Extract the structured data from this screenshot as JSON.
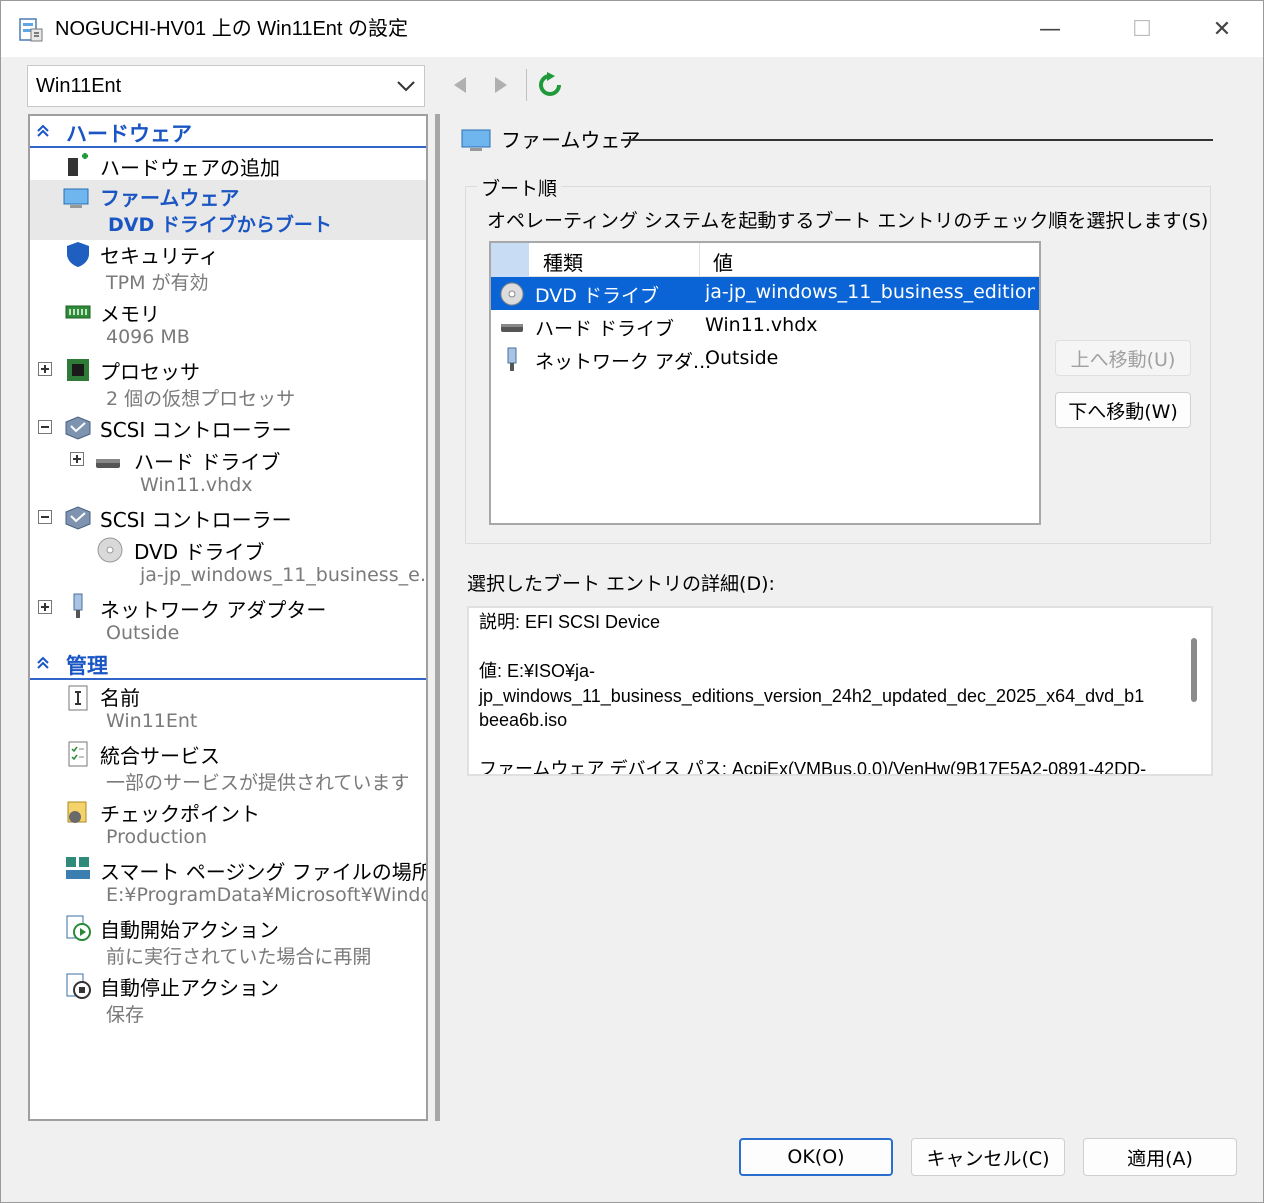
{
  "window": {
    "title": "NOGUCHI-HV01 上の Win11Ent の設定",
    "minimize_glyph": "—",
    "maximize_glyph": "☐",
    "close_glyph": "✕"
  },
  "toolbar": {
    "vm_selected": "Win11Ent"
  },
  "tree": {
    "hardware_section": "ハードウェア",
    "management_section": "管理",
    "items": [
      {
        "name": "ハードウェアの追加",
        "sub": ""
      },
      {
        "name": "ファームウェア",
        "sub": "DVD ドライブからブート"
      },
      {
        "name": "セキュリティ",
        "sub": "TPM が有効"
      },
      {
        "name": "メモリ",
        "sub": "4096 MB"
      },
      {
        "name": "プロセッサ",
        "sub": "2 個の仮想プロセッサ"
      },
      {
        "name": "SCSI コントローラー",
        "sub": ""
      },
      {
        "name": "ハード ドライブ",
        "sub": "Win11.vhdx"
      },
      {
        "name": "SCSI コントローラー",
        "sub": ""
      },
      {
        "name": "DVD ドライブ",
        "sub": "ja-jp_windows_11_business_e…"
      },
      {
        "name": "ネットワーク アダプター",
        "sub": "Outside"
      }
    ],
    "mgmt_items": [
      {
        "name": "名前",
        "sub": "Win11Ent"
      },
      {
        "name": "統合サービス",
        "sub": "一部のサービスが提供されています"
      },
      {
        "name": "チェックポイント",
        "sub": "Production"
      },
      {
        "name": "スマート ページング ファイルの場所",
        "sub": "E:¥ProgramData¥Microsoft¥Windo…"
      },
      {
        "name": "自動開始アクション",
        "sub": "前に実行されていた場合に再開"
      },
      {
        "name": "自動停止アクション",
        "sub": "保存"
      }
    ]
  },
  "firmware": {
    "heading": "ファームウェア",
    "boot_group": "ブート順",
    "boot_desc": "オペレーティング システムを起動するブート エントリのチェック順を選択します(S)",
    "columns": [
      "種類",
      "値"
    ],
    "entries": [
      {
        "type": "DVD ドライブ",
        "value": "ja-jp_windows_11_business_editions..."
      },
      {
        "type": "ハード ドライブ",
        "value": "Win11.vhdx"
      },
      {
        "type": "ネットワーク アダ...",
        "value": "Outside"
      }
    ],
    "move_up": "上へ移動(U)",
    "move_down": "下へ移動(W)",
    "details_label": "選択したブート エントリの詳細(D):",
    "details_text": "説明: EFI SCSI Device\n\n値: E:¥ISO¥ja-\njp_windows_11_business_editions_version_24h2_updated_dec_2025_x64_dvd_b1\nbeea6b.iso\n\nファームウェア デバイス パス: AcpiEx(VMBus,0,0)/VenHw(9B17E5A2-0891-42DD-"
  },
  "footer": {
    "ok": "OK(O)",
    "cancel": "キャンセル(C)",
    "apply": "適用(A)"
  },
  "colors": {
    "selection": "#0a64d6",
    "section_text": "#1a55c4",
    "refresh_green": "#1e9a3a"
  }
}
